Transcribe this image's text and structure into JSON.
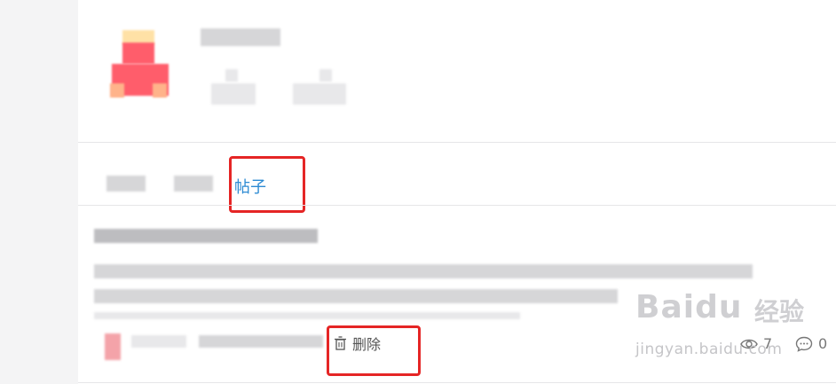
{
  "tabs": {
    "active_label": "帖子"
  },
  "post": {
    "delete_label": "删除",
    "view_count": "7",
    "comment_count": "0"
  },
  "watermark": {
    "logo": "Baidu",
    "name": "经验",
    "url": "jingyan.baidu.com"
  },
  "colors": {
    "accent": "#2d8bd3",
    "highlight_box": "#e52525"
  },
  "icons": [
    "trash-icon",
    "eye-icon",
    "comment-icon"
  ]
}
